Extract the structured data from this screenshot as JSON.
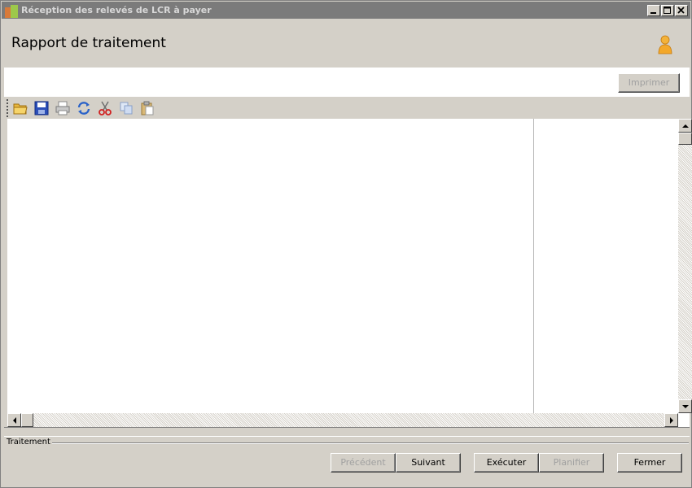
{
  "window": {
    "title": "Réception des relevés de LCR à payer"
  },
  "header": {
    "title": "Rapport de traitement",
    "user_icon": "user-icon"
  },
  "print_strip": {
    "print_label": "Imprimer"
  },
  "toolbar": {
    "icons": [
      "folder-open-icon",
      "save-icon",
      "print-icon",
      "refresh-icon",
      "cut-icon",
      "copy-icon",
      "paste-icon"
    ]
  },
  "footer": {
    "group_label": "Traitement",
    "prev_label": "Précédent",
    "next_label": "Suivant",
    "execute_label": "Exécuter",
    "schedule_label": "Planifier",
    "close_label": "Fermer"
  },
  "colors": {
    "titlebar": "#7b7b7b",
    "face": "#d4d0c8",
    "disabled_text": "#a0a0a0"
  }
}
